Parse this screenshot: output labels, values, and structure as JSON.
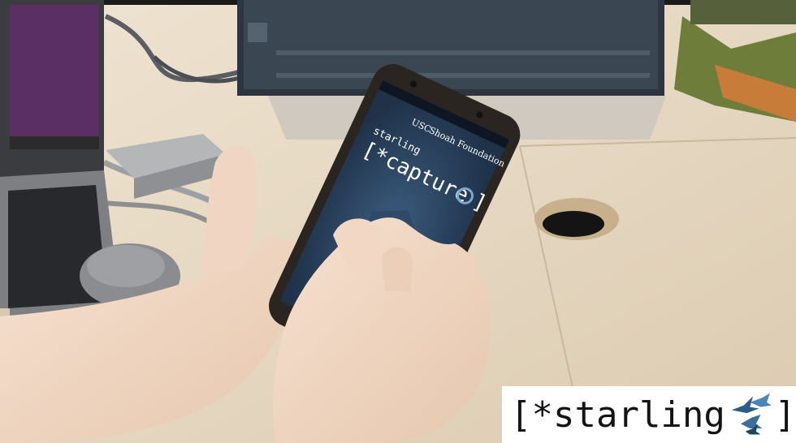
{
  "phone_screen": {
    "foundation_prefix": "USC",
    "foundation_name": "Shoah Foundation",
    "app_name_small": "starling",
    "app_name_large": "[*capture",
    "app_name_close": "]"
  },
  "brand_badge": {
    "text_open": "[*starling",
    "text_close": "]"
  }
}
